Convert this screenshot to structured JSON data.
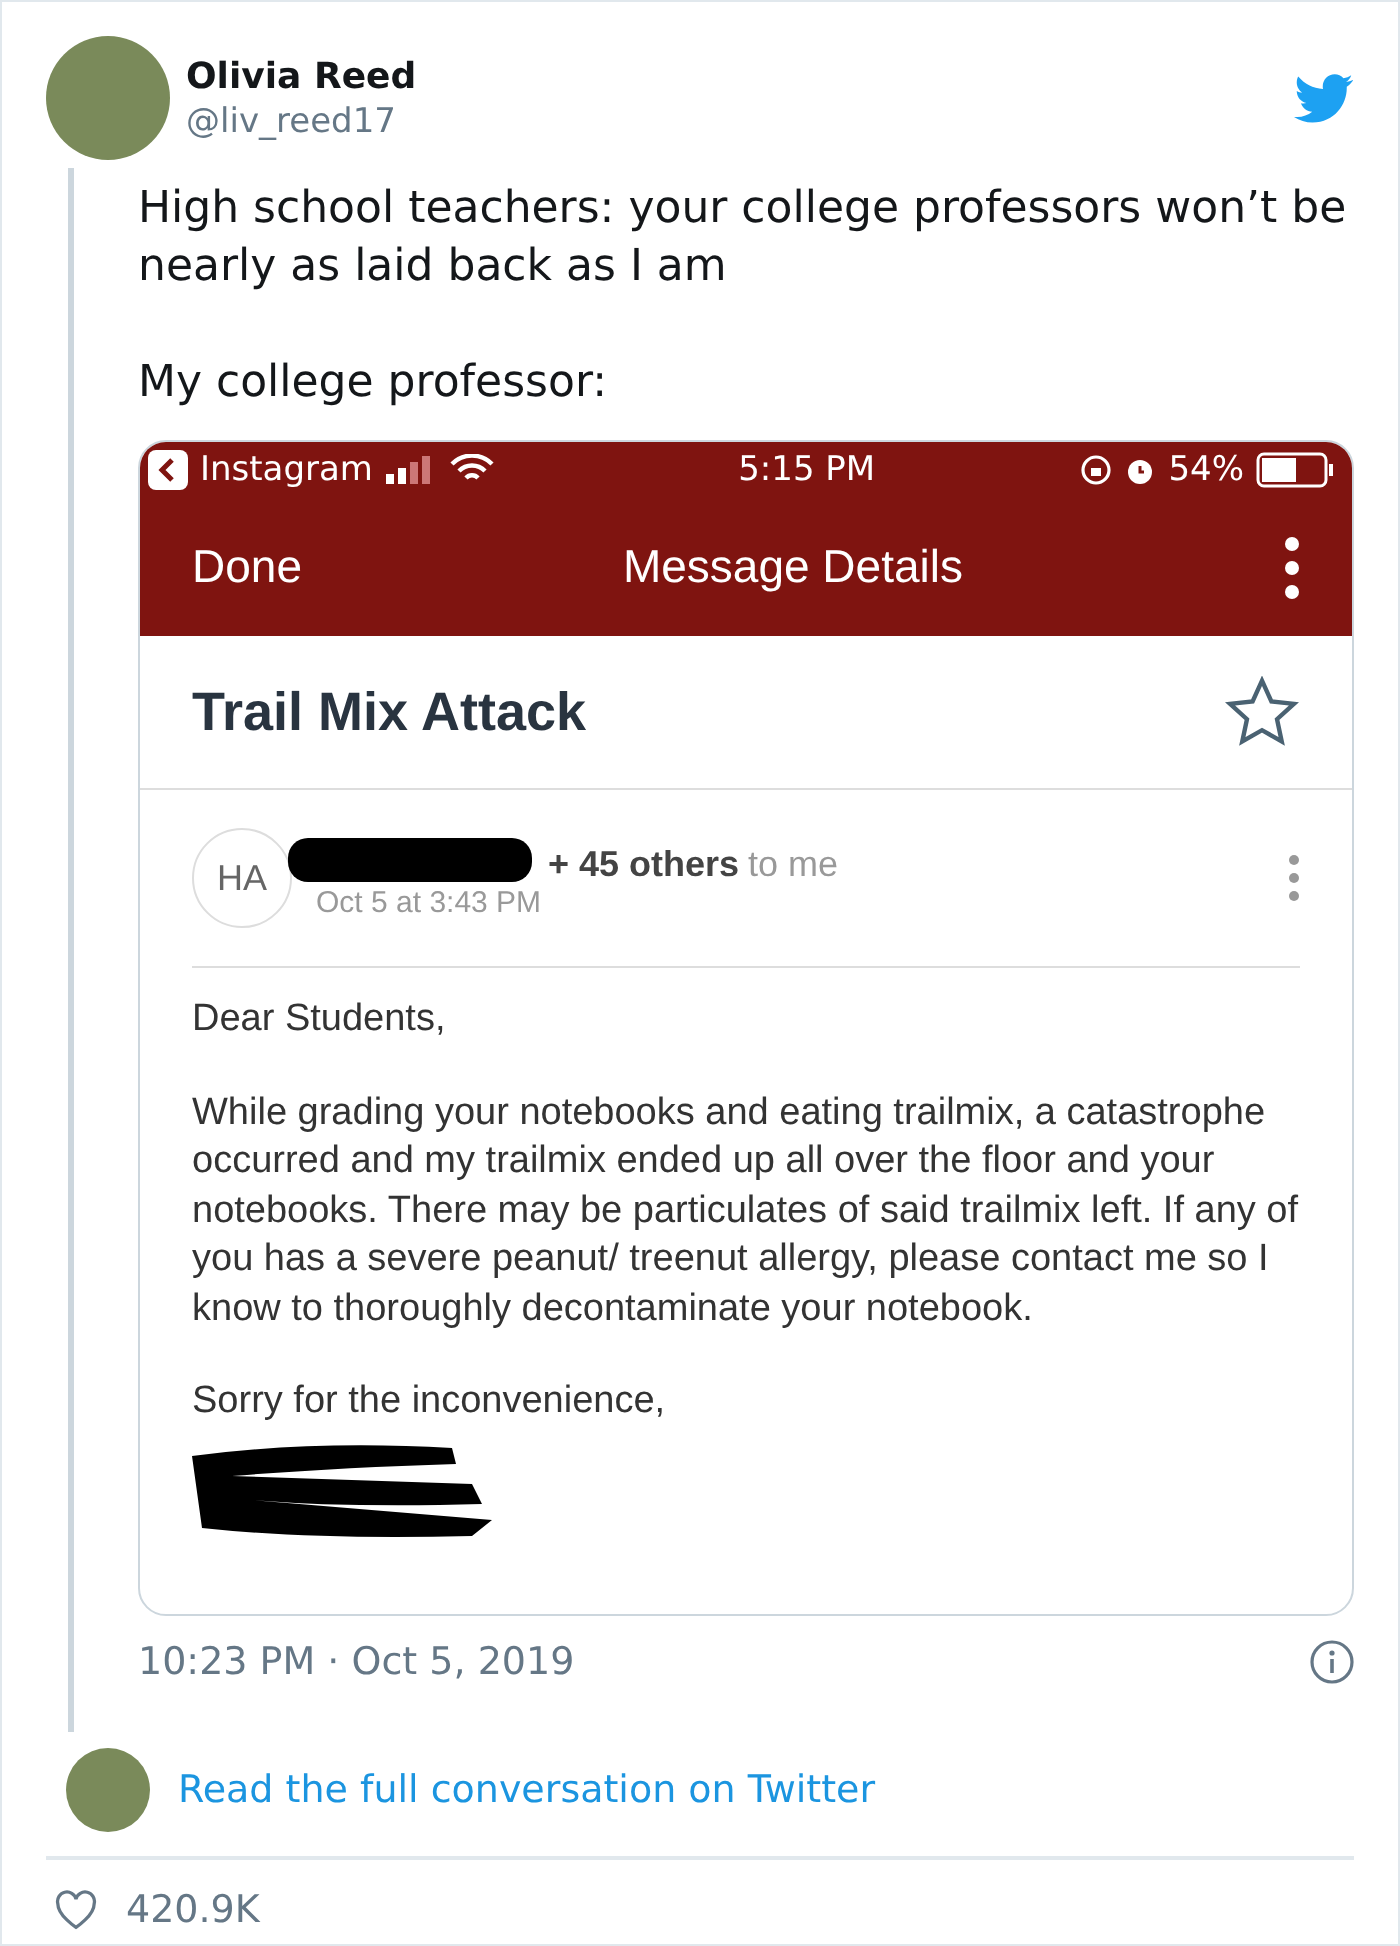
{
  "author": {
    "name": "Olivia Reed",
    "handle": "@liv_reed17"
  },
  "tweet_text": [
    "High school teachers: your college professors won’t be nearly as laid back as I am",
    "My college professor:"
  ],
  "attached_screenshot": {
    "status_bar": {
      "back_app": "Instagram",
      "time": "5:15 PM",
      "battery": "54%"
    },
    "nav_bar": {
      "left": "Done",
      "title": "Message Details"
    },
    "email": {
      "subject": "Trail Mix Attack",
      "starred": false,
      "sender_initials": "HA",
      "recipients": "+ 45 others",
      "to": "to me",
      "date": "Oct 5 at 3:43 PM",
      "body": [
        "Dear Students,",
        "While grading your notebooks and eating trailmix, a catastrophe occurred and my trailmix ended up all over the floor and your notebooks. There may be particulates of said trailmix left. If any of you has a severe peanut/ treenut allergy, please contact me so I know  to thoroughly decontaminate your notebook.",
        "Sorry for the inconvenience,"
      ]
    }
  },
  "timestamp": "10:23 PM · Oct 5, 2019",
  "conversation_link": "Read the full conversation on Twitter",
  "likes": "420.9K"
}
